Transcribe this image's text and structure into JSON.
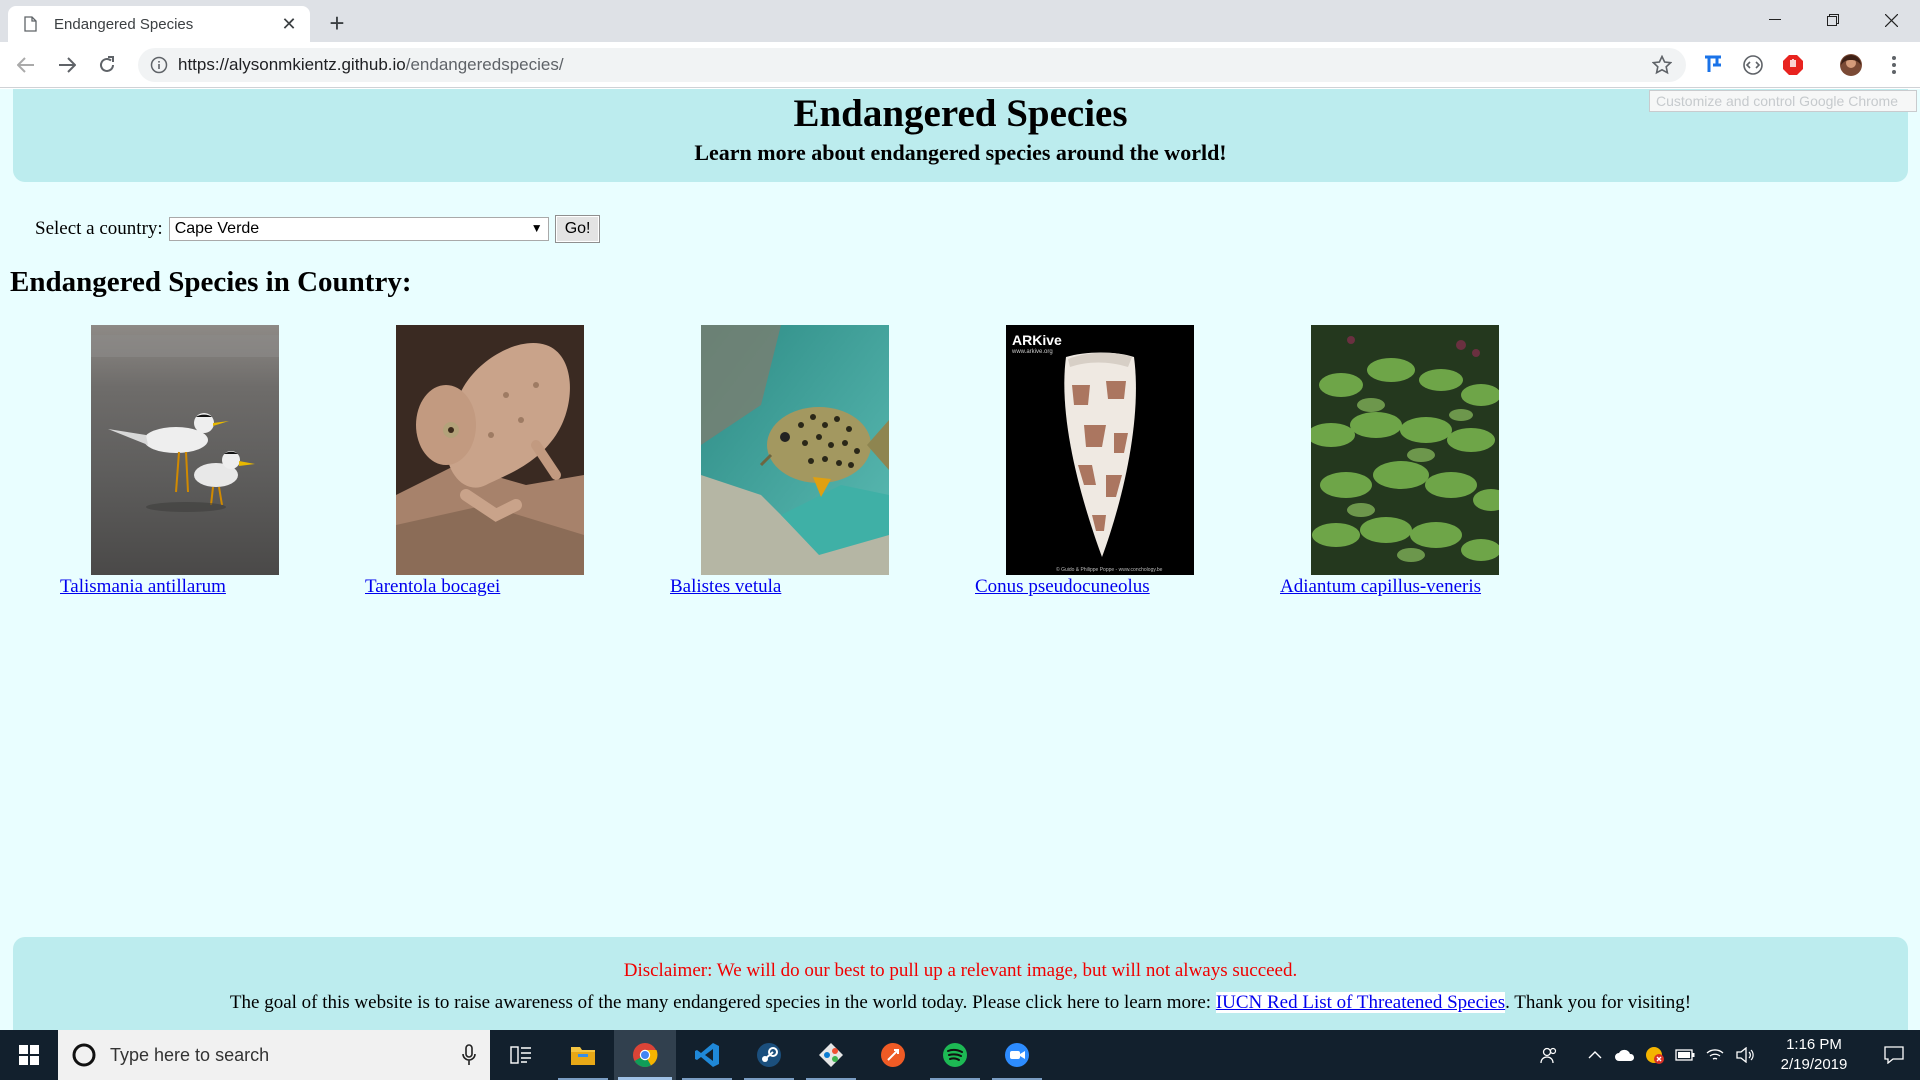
{
  "browser": {
    "tab_title": "Endangered Species",
    "url_host": "https://alysonmkientz.github.io",
    "url_path": "/endangeredspecies/",
    "tooltip": "Customize and control Google Chrome"
  },
  "page": {
    "title": "Endangered Species",
    "subtitle": "Learn more about endangered species around the world!",
    "select_label": "Select a country:",
    "selected_country": "Cape Verde",
    "go_button": "Go!",
    "section_title": "Endangered Species in Country:",
    "species": [
      {
        "name": "Talismania antillarum"
      },
      {
        "name": "Tarentola bocagei"
      },
      {
        "name": "Balistes vetula"
      },
      {
        "name": "Conus pseudocuneolus",
        "watermark": "ARKive",
        "watermark_sub": "www.arkive.org",
        "credit": "© Guido & Philippe Poppe - www.conchology.be"
      },
      {
        "name": "Adiantum capillus-veneris"
      }
    ],
    "disclaimer": "Disclaimer: We will do our best to pull up a relevant image, but will not always succeed.",
    "goal_text": "The goal of this website is to raise awareness of the many endangered species in the world today. Please click here to learn more:",
    "goal_link": "IUCN Red List of Threatened Species",
    "goal_end": ". Thank you for visiting!"
  },
  "taskbar": {
    "search_placeholder": "Type here to search",
    "time": "1:16 PM",
    "date": "2/19/2019"
  },
  "colors": {
    "page_bg": "#e9feff",
    "header_bg": "#bcecee",
    "link": "#0000ee",
    "disclaimer": "#f00000"
  }
}
